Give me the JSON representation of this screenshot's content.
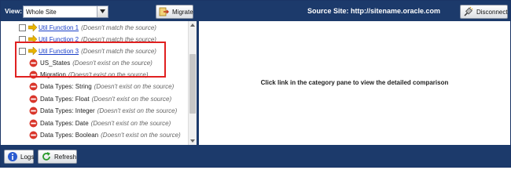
{
  "toolbar": {
    "view_label": "View:",
    "view_value": "Whole Site",
    "migrate_label": "Migrate",
    "source_site": "Source Site: http://sitename.oracle.com",
    "disconnect_label": "Disconnect"
  },
  "tree": {
    "flagged_items": [
      {
        "label": "Util Function 1",
        "note": "(Doesn't match the source)"
      },
      {
        "label": "Util Function 2",
        "note": "(Doesn't match the source)"
      },
      {
        "label": "Util Function 3",
        "note": "(Doesn't match the source)"
      }
    ],
    "missing_items": [
      {
        "label": "US_States",
        "note": "(Doesn't exist on the source)"
      },
      {
        "label": "Migration",
        "note": "(Doesn't exist on the source)"
      },
      {
        "label": "Data Types: String",
        "note": "(Doesn't exist on the source)"
      },
      {
        "label": "Data Types: Float",
        "note": "(Doesn't exist on the source)"
      },
      {
        "label": "Data Types: Integer",
        "note": "(Doesn't exist on the source)"
      },
      {
        "label": "Data Types: Date",
        "note": "(Doesn't exist on the source)"
      },
      {
        "label": "Data Types: Boolean",
        "note": "(Doesn't exist on the source)"
      }
    ]
  },
  "detail": {
    "message": "Click link in the category pane to view the detailed comparison"
  },
  "footer": {
    "logs_label": "Logs",
    "refresh_label": "Refresh"
  },
  "colors": {
    "bar_background": "#1c3a6b",
    "highlight": "#e02020",
    "link": "#1a3fc8",
    "error_icon": "#d9362b",
    "arrow_icon": "#e8b400"
  }
}
